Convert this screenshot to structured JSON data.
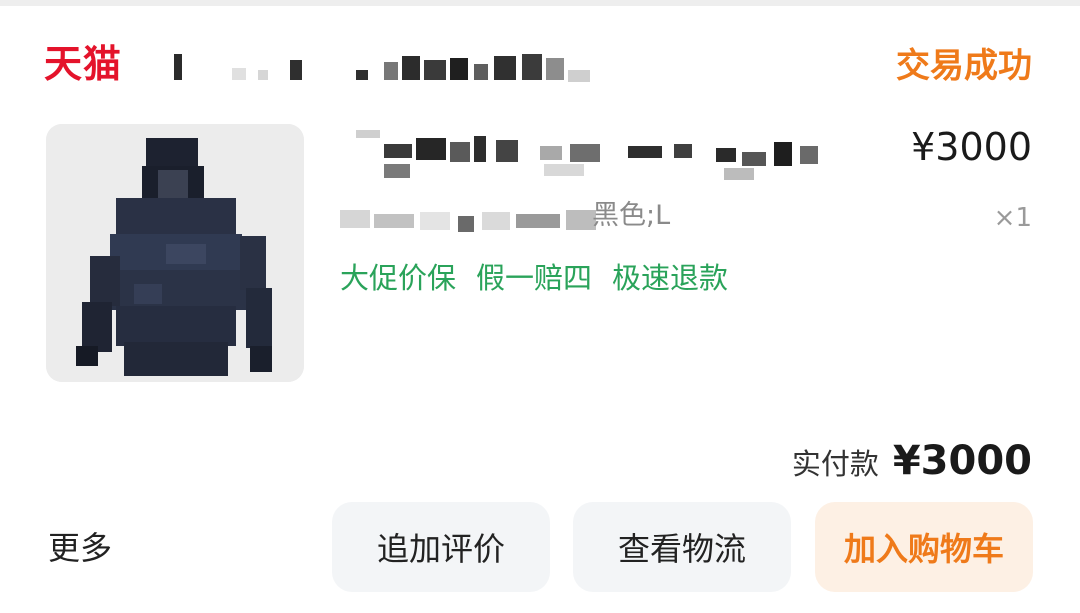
{
  "shop": {
    "platform_logo": "天猫",
    "name": "",
    "status": "交易成功"
  },
  "product": {
    "image_icon": "jacket-thumbnail",
    "title": "",
    "price": "¥3000",
    "sku": "黑色;L",
    "quantity": "×1",
    "badges": [
      "大促价保",
      "假一赔四",
      "极速退款"
    ]
  },
  "payment": {
    "label": "实付款",
    "amount": "¥3000"
  },
  "actions": {
    "more": "更多",
    "review": "追加评价",
    "logistics": "查看物流",
    "add_to_cart": "加入购物车"
  },
  "colors": {
    "brand_red": "#e4132b",
    "status_orange": "#ef7a1a",
    "badge_green": "#2aa35a",
    "button_bg": "#f3f5f7",
    "cart_button_bg": "#fdf0e4"
  }
}
